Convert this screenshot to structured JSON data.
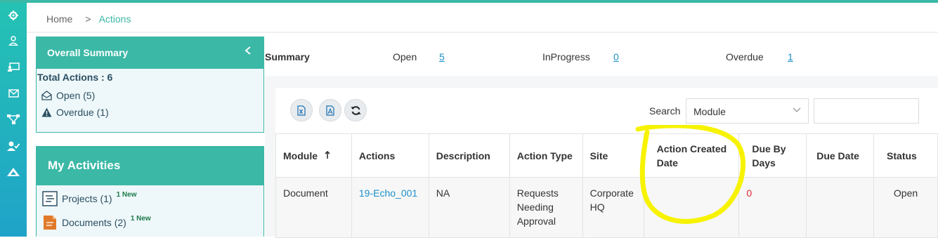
{
  "breadcrumb": {
    "home": "Home",
    "separator": ">",
    "current": "Actions"
  },
  "overall_summary": {
    "title": "Overall Summary",
    "total": "Total Actions : 6",
    "items": [
      {
        "icon": "envelope-open-icon",
        "label": "Open (5)"
      },
      {
        "icon": "warning-icon",
        "label": "Overdue (1)"
      }
    ]
  },
  "my_activities": {
    "title": "My Activities",
    "items": [
      {
        "icon": "projects-icon",
        "label": "Projects (1)",
        "badge": "1 New"
      },
      {
        "icon": "documents-icon",
        "label": "Documents (2)",
        "badge": "1 New"
      }
    ]
  },
  "summary_bar": {
    "title": "Summary",
    "open_label": "Open",
    "open_value": "5",
    "inprogress_label": "InProgress",
    "inprogress_value": "0",
    "overdue_label": "Overdue",
    "overdue_value": "1"
  },
  "toolbar": {
    "search_label": "Search",
    "search_field_value": "Module",
    "search_input_value": ""
  },
  "table": {
    "columns": [
      "Module",
      "Actions",
      "Description",
      "Action Type",
      "Site",
      "Action Created Date",
      "Due By Days",
      "Due Date",
      "Status"
    ],
    "rows": [
      [
        "Document",
        "19-Echo_001",
        "NA",
        "Requests Needing Approval",
        "Corporate HQ",
        "",
        "0",
        "",
        "Open"
      ]
    ]
  },
  "colors": {
    "accent": "#3bb8a6",
    "link": "#1a8fc9",
    "highlight": "#f7f300",
    "overdue": "#e0242f"
  }
}
